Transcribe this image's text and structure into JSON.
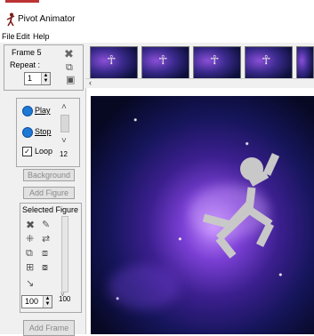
{
  "app": {
    "title": "Pivot Animator"
  },
  "menu": {
    "file": "File",
    "edit": "Edit",
    "help": "Help"
  },
  "frame_panel": {
    "frame_label": "Frame 5",
    "repeat_label": "Repeat :",
    "repeat_value": "1"
  },
  "playback": {
    "play": "Play",
    "stop": "Stop",
    "loop": "Loop",
    "speed_value": "12"
  },
  "buttons": {
    "background": "Background",
    "add_figure": "Add Figure",
    "add_frame": "Add Frame"
  },
  "selected_figure": {
    "label": "Selected Figure",
    "size_value": "100",
    "size_max_label": "100"
  },
  "filmstrip": {
    "thumb_count": 5
  },
  "colors": {
    "accent_blue": "#1e78d6",
    "figure_gray": "#c8c8c8"
  }
}
